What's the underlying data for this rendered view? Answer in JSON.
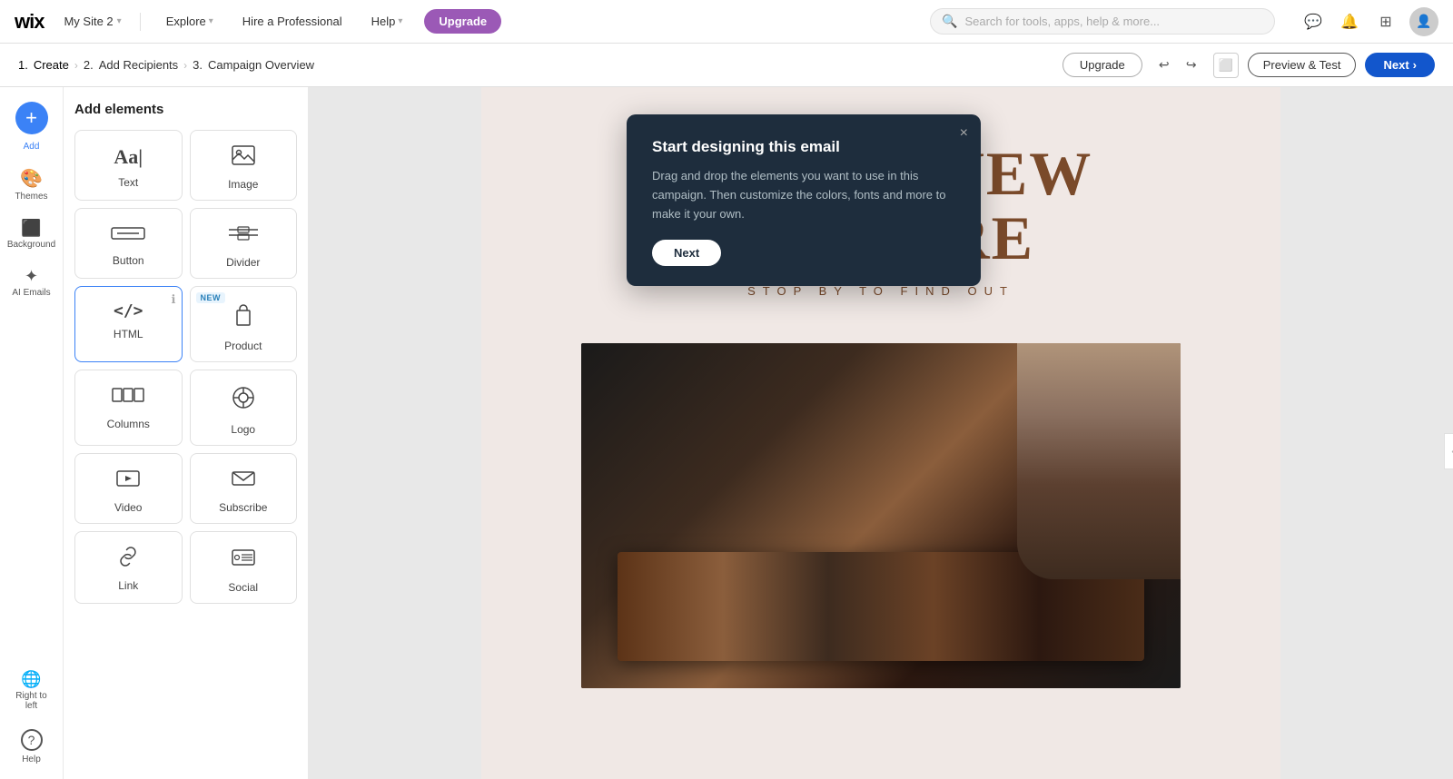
{
  "topNav": {
    "logo": "wix",
    "siteName": "My Site 2",
    "siteNameChevron": "▾",
    "navItems": [
      {
        "label": "Explore",
        "hasDropdown": true
      },
      {
        "label": "Hire a Professional",
        "hasDropdown": false
      },
      {
        "label": "Help",
        "hasDropdown": true
      }
    ],
    "upgradeLabel": "Upgrade",
    "searchPlaceholder": "Search for tools, apps, help & more...",
    "icons": [
      "chat",
      "bell",
      "grid",
      "user"
    ]
  },
  "breadcrumb": {
    "steps": [
      {
        "num": "1.",
        "label": "Create",
        "active": true
      },
      {
        "num": "2.",
        "label": "Add Recipients",
        "active": false
      },
      {
        "num": "3.",
        "label": "Campaign Overview",
        "active": false
      }
    ],
    "upgradeLabel": "Upgrade",
    "undoIcon": "↩",
    "redoIcon": "↪",
    "desktopIcon": "⬜",
    "previewTestLabel": "Preview & Test",
    "nextLabel": "Next",
    "nextIcon": "›"
  },
  "sidebar": {
    "addLabel": "Add",
    "items": [
      {
        "id": "add",
        "icon": "+",
        "label": ""
      },
      {
        "id": "themes",
        "icon": "🎨",
        "label": "Themes"
      },
      {
        "id": "background",
        "icon": "⬛",
        "label": "Background"
      },
      {
        "id": "ai-emails",
        "icon": "✦",
        "label": "AI Emails"
      },
      {
        "id": "right-to-left",
        "icon": "🌐",
        "label": "Right to left"
      },
      {
        "id": "help",
        "icon": "?",
        "label": "Help"
      }
    ]
  },
  "elementsPanel": {
    "title": "Add elements",
    "items": [
      {
        "id": "text",
        "icon": "Aa",
        "label": "Text",
        "isText": true
      },
      {
        "id": "image",
        "icon": "🖼",
        "label": "Image"
      },
      {
        "id": "button",
        "icon": "▬",
        "label": "Button"
      },
      {
        "id": "divider",
        "icon": "⚊⚊",
        "label": "Divider"
      },
      {
        "id": "html",
        "icon": "</>",
        "label": "HTML",
        "isCode": true,
        "hasInfo": true
      },
      {
        "id": "product",
        "icon": "🛍",
        "label": "Product",
        "isNew": true
      },
      {
        "id": "columns",
        "icon": "⊟⊟",
        "label": "Columns"
      },
      {
        "id": "logo",
        "icon": "◎",
        "label": "Logo"
      },
      {
        "id": "video",
        "icon": "▶",
        "label": "Video"
      },
      {
        "id": "subscribe",
        "icon": "✉",
        "label": "Subscribe"
      },
      {
        "id": "link",
        "icon": "🔗",
        "label": "Link"
      },
      {
        "id": "social",
        "icon": "📣",
        "label": "Social"
      }
    ]
  },
  "canvas": {
    "headline1": "WHAT'S NEW",
    "headline2": "IN STORE",
    "subheadline": "STOP BY TO FIND OUT"
  },
  "tooltip": {
    "title": "Start designing this email",
    "text": "Drag and drop the elements you want to use in this campaign. Then customize the colors, fonts and more to make it your own.",
    "nextLabel": "Next",
    "closeIcon": "×"
  }
}
